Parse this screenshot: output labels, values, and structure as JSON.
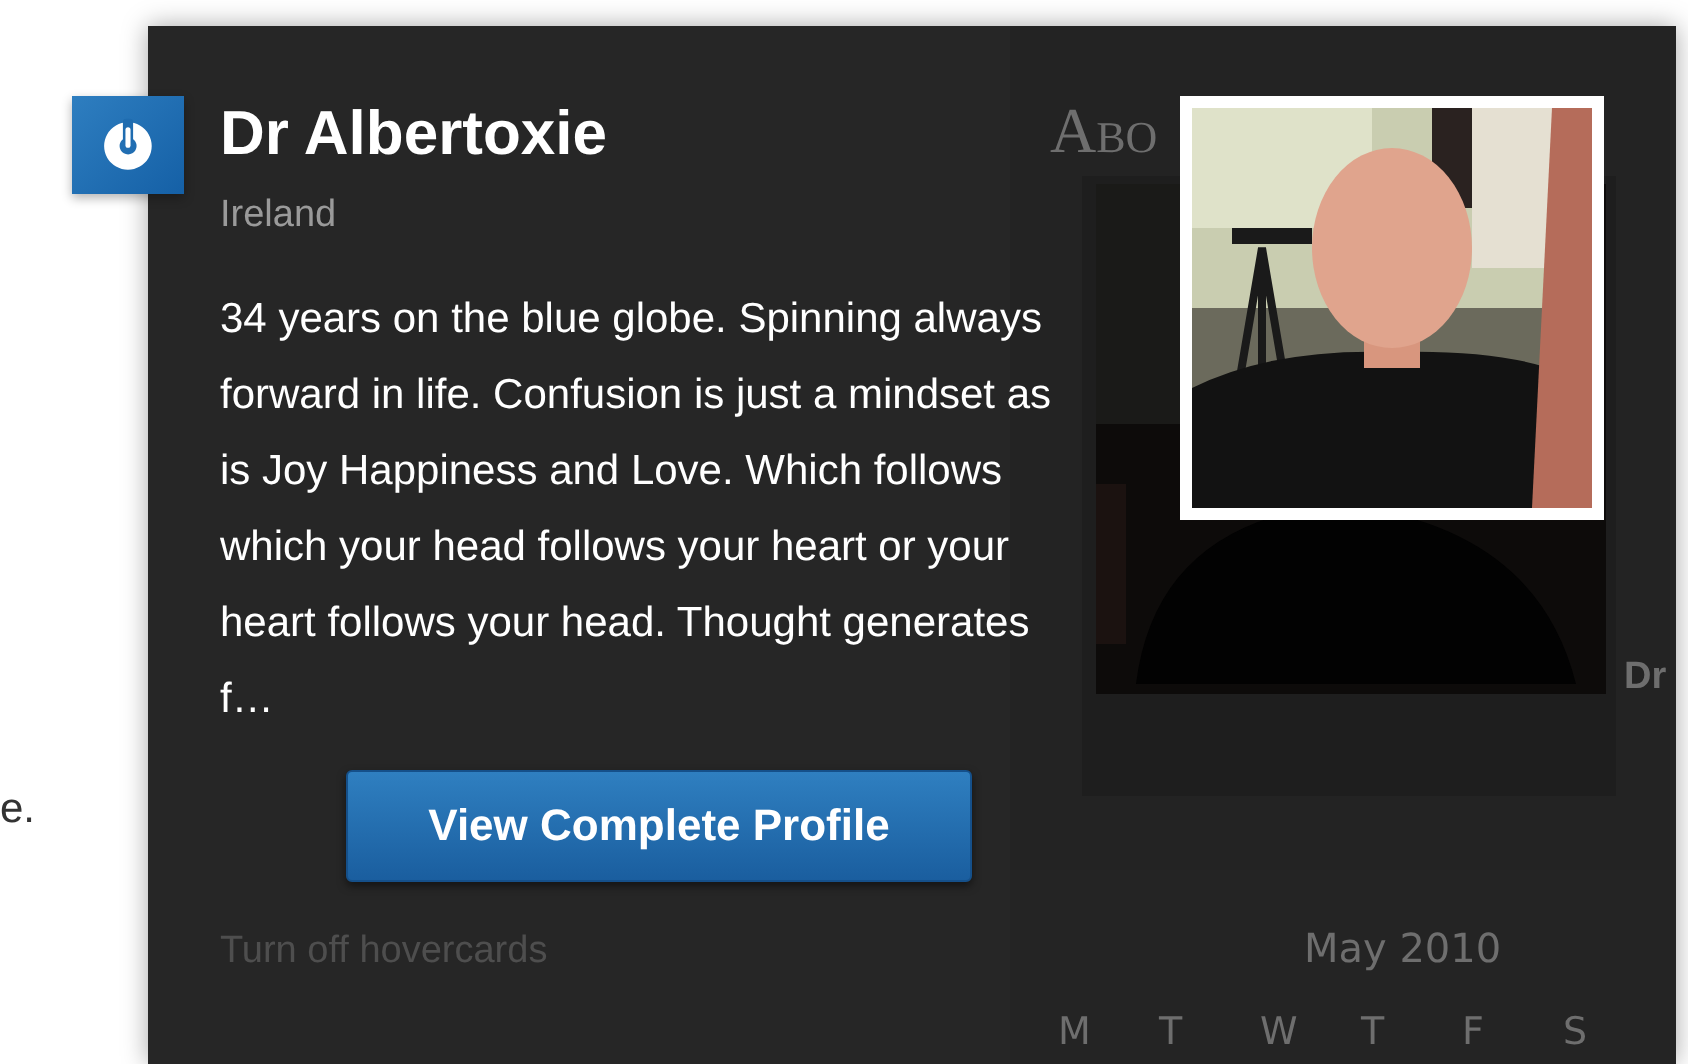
{
  "page_behind": {
    "text_fragment": "e.",
    "heading": "Abo",
    "name_fragment": "Dr",
    "calendar": {
      "title": "May 2010",
      "weekdays": [
        "M",
        "T",
        "W",
        "T",
        "F",
        "S"
      ]
    }
  },
  "hovercard": {
    "name": "Dr Albertoxie",
    "location": "Ireland",
    "bio": "34 years on the blue globe. Spinning always forward in life. Confusion is just a mindset as is Joy Happiness and Love. Which follows which your head follows your heart or your heart follows your head. Thought generates f…",
    "button": "View Complete Profile",
    "footer_link": "Turn off hovercards"
  }
}
